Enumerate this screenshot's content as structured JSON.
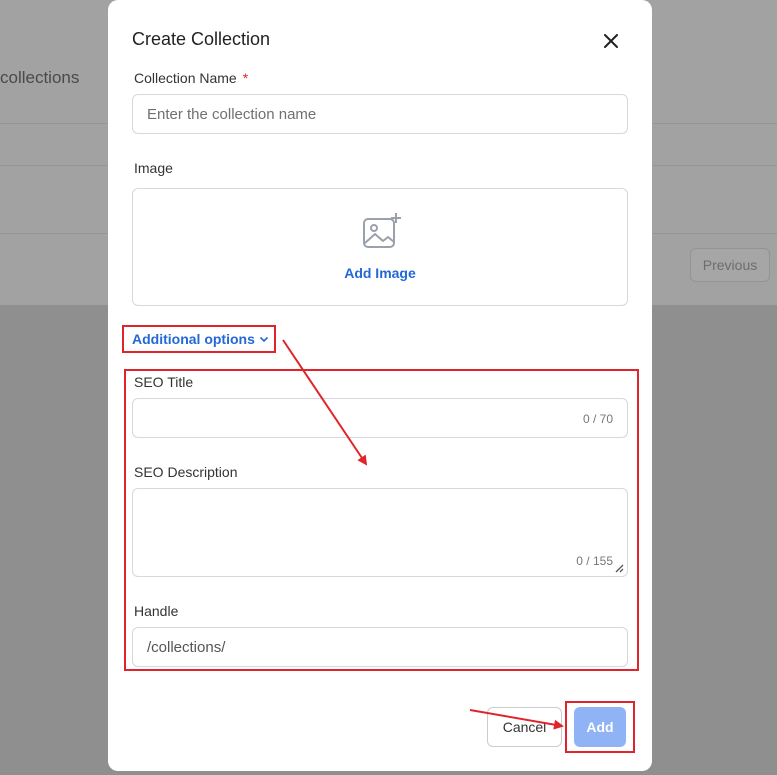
{
  "background": {
    "page_title": "collections",
    "previous_label": "Previous"
  },
  "modal": {
    "title": "Create Collection",
    "collection_name": {
      "label": "Collection Name",
      "required_mark": "*",
      "placeholder": "Enter the collection name"
    },
    "image": {
      "label": "Image",
      "add_label": "Add Image",
      "icon": "image-plus-icon"
    },
    "additional_options_label": "Additional options",
    "seo_title": {
      "label": "SEO Title",
      "counter": "0 / 70"
    },
    "seo_description": {
      "label": "SEO Description",
      "counter": "0 / 155"
    },
    "handle": {
      "label": "Handle",
      "value": "/collections/"
    },
    "buttons": {
      "cancel": "Cancel",
      "add": "Add"
    }
  },
  "colors": {
    "accent": "#2468d6",
    "annotation_red": "#e0242c",
    "add_button": "#8fb3f5"
  }
}
